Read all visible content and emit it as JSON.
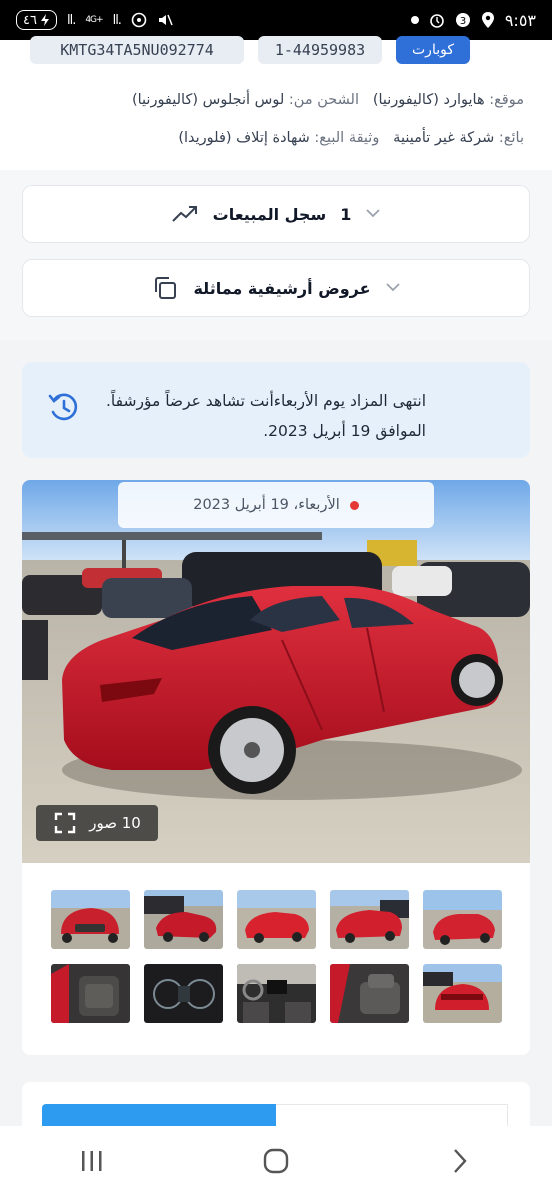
{
  "status_bar": {
    "time": "٩:٥٣",
    "battery": "٤٦",
    "network": "4G+"
  },
  "vehicle": {
    "vin": "KMTG34TA5NU092774",
    "lot_number": "1-44959983",
    "brand_button": "كوبارت"
  },
  "info": {
    "location_label": "موقع:",
    "location_value": "هايوارد (كاليفورنيا)",
    "shipping_label": "الشحن من:",
    "shipping_value": "لوس أنجلوس (كاليفورنيا)",
    "seller_label": "بائع:",
    "seller_value": "شركة غير تأمينية",
    "doc_label": "وثيقة البيع:",
    "doc_value": "شهادة إتلاف (فلوريدا)"
  },
  "accordions": {
    "sales_history_label": "سجل المبيعات",
    "sales_history_count": "1",
    "similar_archive_label": "عروض أرشيفية مماثلة"
  },
  "notice": {
    "line1": "انتهى المزاد يوم الأربعاءأنت تشاهد عرضاً مؤرشفاً.",
    "line2": "الموافق 19 أبريل 2023."
  },
  "gallery": {
    "date": "الأربعاء، 19 أبريل 2023",
    "photo_count": "10 صور",
    "thumbnails": [
      "front-left",
      "front-left-2",
      "side",
      "front-right",
      "front",
      "rear",
      "interior-front",
      "dashboard",
      "gauges",
      "seats"
    ]
  },
  "colors": {
    "accent": "#2f6fd8",
    "notice_bg": "#e6f0fb",
    "car": "#c8102e",
    "tab_active": "#2d9bf0"
  },
  "icons": {
    "trend": "trend-up-icon",
    "copy": "copy-icon",
    "history": "history-icon",
    "expand": "expand-icon"
  }
}
